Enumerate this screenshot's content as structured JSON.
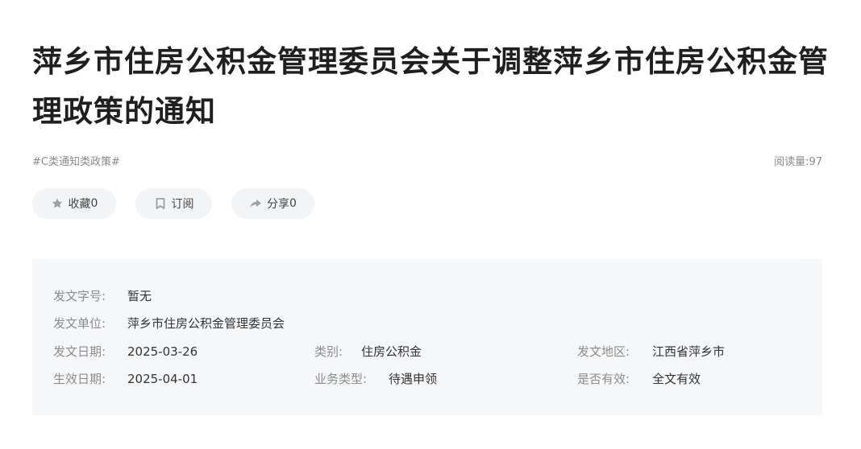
{
  "article": {
    "title": "萍乡市住房公积金管理委员会关于调整萍乡市住房公积金管理政策的通知",
    "tag": "#C类通知类政策#",
    "reads_label": "阅读量:",
    "reads_value": "97"
  },
  "actions": {
    "collect_label": "收藏",
    "collect_count": "0",
    "subscribe_label": "订阅",
    "share_label": "分享",
    "share_count": "0"
  },
  "info": {
    "doc_number_label": "发文字号:",
    "doc_number_value": "暂无",
    "issuer_label": "发文单位:",
    "issuer_value": "萍乡市住房公积金管理委员会",
    "issue_date_label": "发文日期:",
    "issue_date_value": "2025-03-26",
    "category_label": "类别:",
    "category_value": "住房公积金",
    "region_label": "发文地区:",
    "region_value": "江西省萍乡市",
    "effective_date_label": "生效日期:",
    "effective_date_value": "2025-04-01",
    "business_type_label": "业务类型:",
    "business_type_value": "待遇申领",
    "validity_label": "是否有效:",
    "validity_value": "全文有效"
  },
  "icons": {
    "collect": "star-icon",
    "subscribe": "bookmark-icon",
    "share": "share-arrow-icon"
  }
}
